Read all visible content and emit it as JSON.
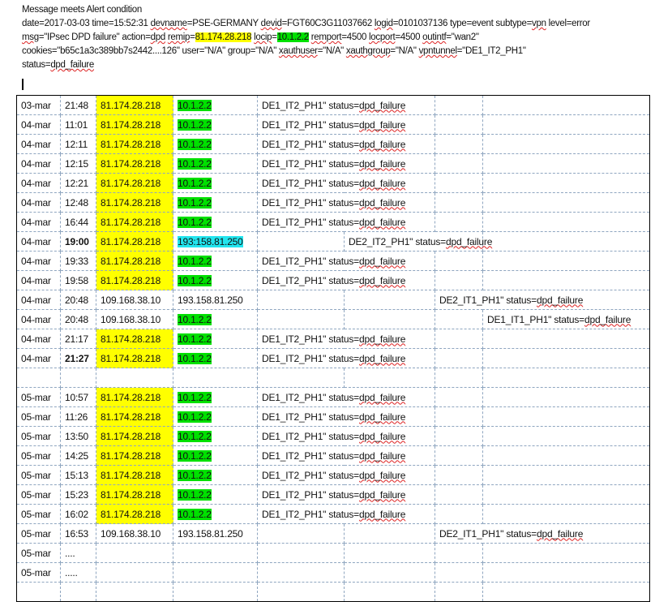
{
  "header": {
    "title": "Message meets Alert condition",
    "line1": {
      "date": "date=2017-03-03",
      "time": "time=15:52:31",
      "devname_k": "devname",
      "devname_v": "=PSE-GERMANY",
      "devid_k": "devid",
      "devid_v": "=FGT60C3G11037662",
      "logid_k": "logid",
      "logid_v": "=0101037136 type=event subtype=",
      "vpn": "vpn",
      "rest": " level=error"
    },
    "line2": {
      "msg_k": "msg",
      "msg_v": "=\"IPsec DPD failure\" action=",
      "dpd": "dpd",
      "remip_k": "remip",
      "eq": "=",
      "remip_v": "81.174.28.218",
      "locip_k": "locip",
      "locip_v": "10.1.2.2",
      "remport_k": "remport",
      "remport_v": "=4500 ",
      "locport_k": "locport",
      "locport_v": "=4500 ",
      "outintf_k": "outintf",
      "outintf_v": "=\"wan2\""
    },
    "line3": {
      "a": "cookies=\"b65c1a3c389bb7s2442....126\" user=\"N/A\" group=\"N/A\" ",
      "xauthuser": "xauthuser",
      "b": "=\"N/A\" ",
      "xauthgroup": "xauthgroup",
      "c": "=\"N/A\" ",
      "vpntunnel": "vpntunnel",
      "d": "=\"DE1_IT2_PH1\""
    },
    "line4": {
      "a": "status=",
      "b": "dpd_failure"
    }
  },
  "rows": [
    {
      "date": "03-mar",
      "time": "21:48",
      "remip": "81.174.28.218",
      "locip": "10.1.2.2",
      "tunnel": "DE1_IT2_PH1\" status=",
      "status": "dpd_failure"
    },
    {
      "date": "04-mar",
      "time": "11:01",
      "remip": "81.174.28.218",
      "locip": "10.1.2.2",
      "tunnel": "DE1_IT2_PH1\" status=",
      "status": "dpd_failure"
    },
    {
      "date": "04-mar",
      "time": "12:11",
      "remip": "81.174.28.218",
      "locip": "10.1.2.2",
      "tunnel": "DE1_IT2_PH1\" status=",
      "status": "dpd_failure"
    },
    {
      "date": "04-mar",
      "time": "12:15",
      "remip": "81.174.28.218",
      "locip": "10.1.2.2",
      "tunnel": "DE1_IT2_PH1\" status=",
      "status": "dpd_failure"
    },
    {
      "date": "04-mar",
      "time": "12:21",
      "remip": "81.174.28.218",
      "locip": "10.1.2.2",
      "tunnel": "DE1_IT2_PH1\" status=",
      "status": "dpd_failure"
    },
    {
      "date": "04-mar",
      "time": "12:48",
      "remip": "81.174.28.218",
      "locip": "10.1.2.2",
      "tunnel": "DE1_IT2_PH1\" status=",
      "status": "dpd_failure"
    },
    {
      "date": "04-mar",
      "time": "16:44",
      "remip": "81.174.28.218",
      "locip": "10.1.2.2",
      "tunnel": "DE1_IT2_PH1\" status=",
      "status": "dpd_failure"
    },
    {
      "date": "04-mar",
      "time": "19:00",
      "remip": "81.174.28.218",
      "locip": "193:158.81.250",
      "tunnel": "DE2_IT2_PH1\" status=",
      "status": "dpd_failure"
    },
    {
      "date": "04-mar",
      "time": "19:33",
      "remip": "81.174.28.218",
      "locip": "10.1.2.2",
      "tunnel": "DE1_IT2_PH1\" status=",
      "status": "dpd_failure"
    },
    {
      "date": "04-mar",
      "time": "19:58",
      "remip": "81.174.28.218",
      "locip": "10.1.2.2",
      "tunnel": "DE1_IT2_PH1\" status=",
      "status": "dpd_failure"
    },
    {
      "date": "04-mar",
      "time": "20:48",
      "remip": "109.168.38.10",
      "locip": "193.158.81.250",
      "tunnel": "DE2_IT1_PH1\" status=",
      "status": "dpd_failure"
    },
    {
      "date": "04-mar",
      "time": "20:48",
      "remip": "109.168.38.10",
      "locip": "10.1.2.2",
      "tunnel": "DE1_IT1_PH1\" status=",
      "status": "dpd_failure"
    },
    {
      "date": "04-mar",
      "time": "21:17",
      "remip": "81.174.28.218",
      "locip": "10.1.2.2",
      "tunnel": "DE1_IT2_PH1\" status=",
      "status": "dpd_failure"
    },
    {
      "date": "04-mar",
      "time": "21:27",
      "remip": "81.174.28.218",
      "locip": "10.1.2.2",
      "tunnel": "DE1_IT2_PH1\" status=",
      "status": "dpd_failure"
    },
    {},
    {
      "date": "05-mar",
      "time": "10:57",
      "remip": "81.174.28.218",
      "locip": "10.1.2.2",
      "tunnel": "DE1_IT2_PH1\" status=",
      "status": "dpd_failure"
    },
    {
      "date": "05-mar",
      "time": "11:26",
      "remip": "81.174.28.218",
      "locip": "10.1.2.2",
      "tunnel": "DE1_IT2_PH1\" status=",
      "status": "dpd_failure"
    },
    {
      "date": "05-mar",
      "time": "13:50",
      "remip": "81.174.28.218",
      "locip": "10.1.2.2",
      "tunnel": "DE1_IT2_PH1\" status=",
      "status": "dpd_failure"
    },
    {
      "date": "05-mar",
      "time": "14:25",
      "remip": "81.174.28.218",
      "locip": "10.1.2.2",
      "tunnel": "DE1_IT2_PH1\" status=",
      "status": "dpd_failure"
    },
    {
      "date": "05-mar",
      "time": "15:13",
      "remip": "81.174.28.218",
      "locip": "10.1.2.2",
      "tunnel": "DE1_IT2_PH1\" status=",
      "status": "dpd_failure"
    },
    {
      "date": "05-mar",
      "time": "15:23",
      "remip": "81.174.28.218",
      "locip": "10.1.2.2",
      "tunnel": "DE1_IT2_PH1\" status=",
      "status": "dpd_failure"
    },
    {
      "date": "05-mar",
      "time": "16:02",
      "remip": "81.174.28.218",
      "locip": "10.1.2.2",
      "tunnel": "DE1_IT2_PH1\" status=",
      "status": "dpd_failure"
    },
    {
      "date": "05-mar",
      "time": "16:53",
      "remip": "109.168.38.10",
      "locip": "193.158.81.250",
      "tunnel": "DE2_IT1_PH1\" status=",
      "status": "dpd_failure"
    },
    {
      "date": "05-mar",
      "time": "...."
    },
    {
      "date": "05-mar",
      "time": "....."
    },
    {}
  ],
  "colors": {
    "remip_highlight": "#ffff00",
    "locip_highlight": "#00e000",
    "alt_locip_highlight": "#22e5ee"
  }
}
